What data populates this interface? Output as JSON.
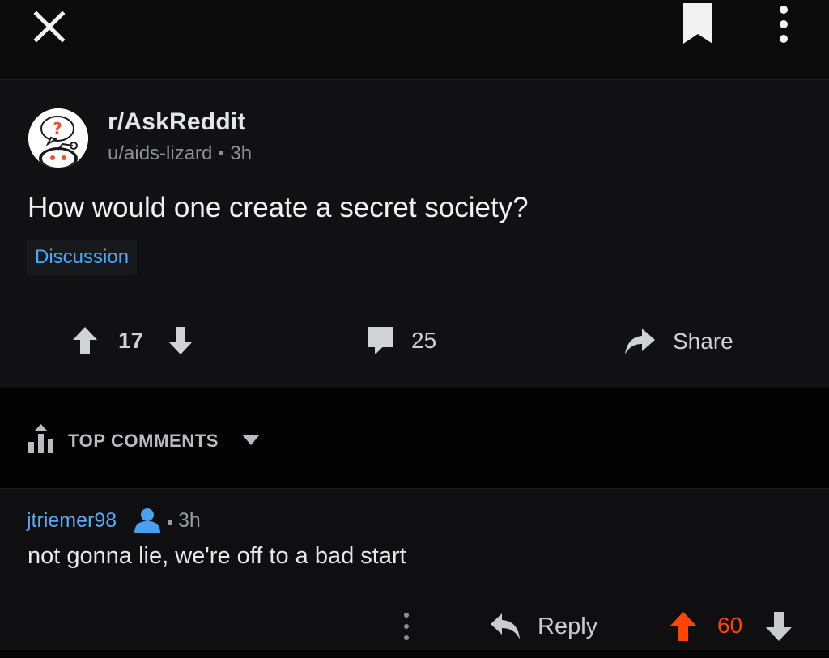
{
  "topbar": {
    "close_icon": "close-icon",
    "bookmark_icon": "bookmark-icon",
    "more_icon": "vertical-ellipsis-icon"
  },
  "post": {
    "subreddit": "r/AskReddit",
    "author": "u/aids-lizard",
    "age": "3h",
    "title": "How would one create a secret society?",
    "flair": "Discussion",
    "score": "17",
    "comment_count": "25",
    "share_label": "Share",
    "colors": {
      "flair_text": "#4aa8ff",
      "background": "#111113"
    }
  },
  "sort": {
    "label": "TOP COMMENTS",
    "icon": "sort-bars-icon"
  },
  "comment": {
    "author": "jtriemer98",
    "age": "3h",
    "body": "not gonna lie, we're off to a bad start",
    "reply_label": "Reply",
    "score": "60",
    "colors": {
      "author": "#5aa9f5",
      "upvoted": "#ff4500"
    }
  }
}
